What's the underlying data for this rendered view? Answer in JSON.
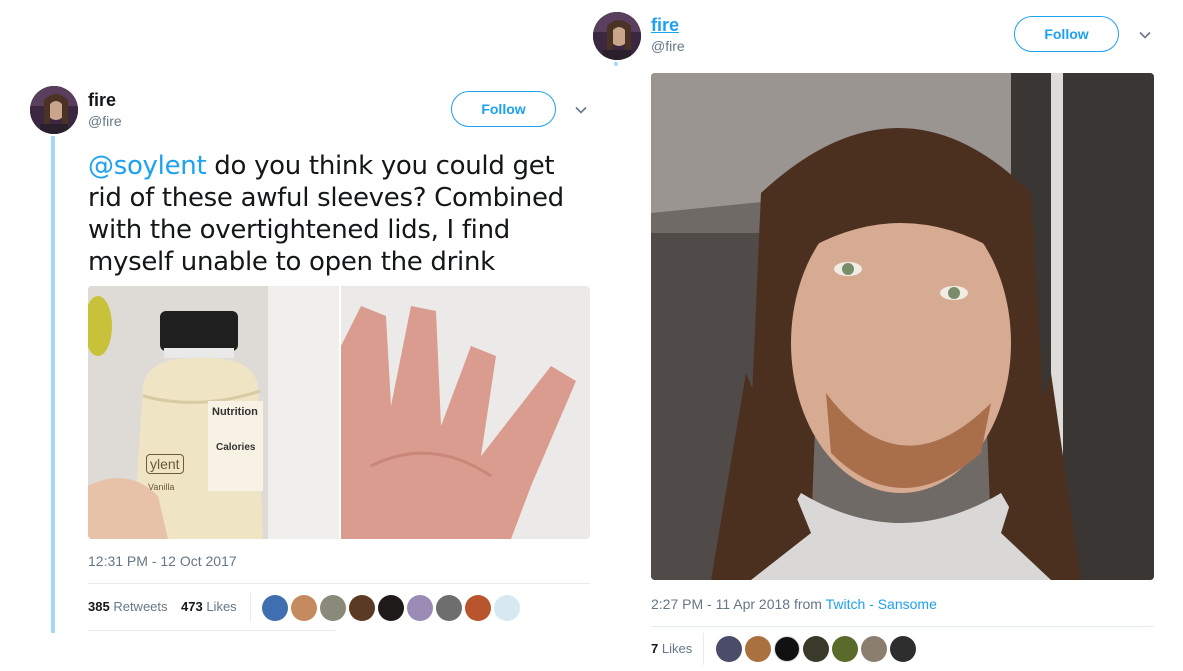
{
  "left_tweet": {
    "name": "fire",
    "handle": "@fire",
    "follow_label": "Follow",
    "mention": "@soylent",
    "text": " do you think you could get rid of these awful sleeves? Combined with the overtightened lids, I find myself unable to open the drink",
    "timestamp": "12:31 PM - 12 Oct 2017",
    "retweets_count": "385",
    "retweets_label": "Retweets",
    "likes_count": "473",
    "likes_label": "Likes",
    "photo1_label_nutrition": "Nutrition",
    "photo1_label_calories": "Calories",
    "photo1_label_brand": "ylent",
    "photo1_label_flavor": "Vanilla"
  },
  "right_tweet": {
    "name": "fire",
    "handle": "@fire",
    "follow_label": "Follow",
    "timestamp": "2:27 PM - 11 Apr 2018",
    "from_label": "from",
    "source": "Twitch - Sansome",
    "likes_count": "7",
    "likes_label": "Likes"
  },
  "colors": {
    "accent": "#1da1f2",
    "thread_line": "#a3d9f7",
    "muted": "#657786"
  },
  "icons": [
    "chevron-down-icon"
  ]
}
